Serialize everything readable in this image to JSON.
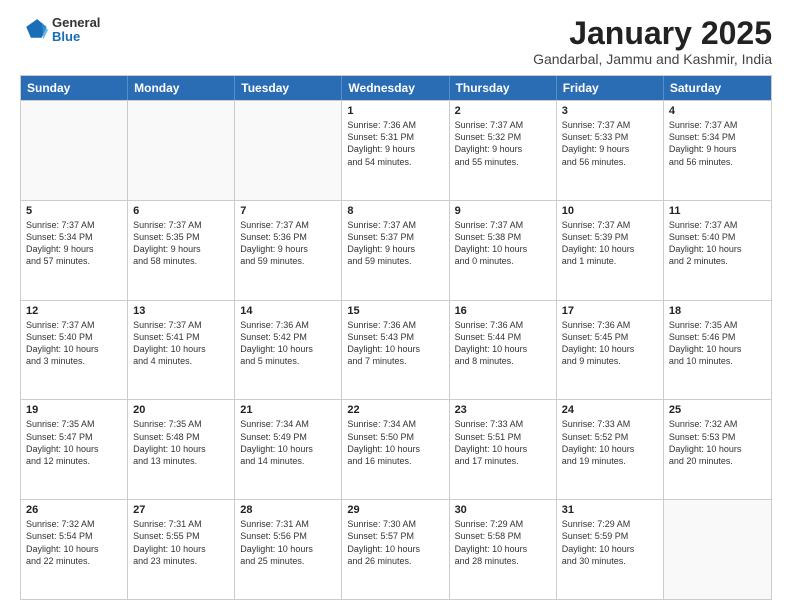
{
  "header": {
    "logo_general": "General",
    "logo_blue": "Blue",
    "month_title": "January 2025",
    "subtitle": "Gandarbal, Jammu and Kashmir, India"
  },
  "days_of_week": [
    "Sunday",
    "Monday",
    "Tuesday",
    "Wednesday",
    "Thursday",
    "Friday",
    "Saturday"
  ],
  "weeks": [
    [
      {
        "day": "",
        "info": []
      },
      {
        "day": "",
        "info": []
      },
      {
        "day": "",
        "info": []
      },
      {
        "day": "1",
        "info": [
          "Sunrise: 7:36 AM",
          "Sunset: 5:31 PM",
          "Daylight: 9 hours",
          "and 54 minutes."
        ]
      },
      {
        "day": "2",
        "info": [
          "Sunrise: 7:37 AM",
          "Sunset: 5:32 PM",
          "Daylight: 9 hours",
          "and 55 minutes."
        ]
      },
      {
        "day": "3",
        "info": [
          "Sunrise: 7:37 AM",
          "Sunset: 5:33 PM",
          "Daylight: 9 hours",
          "and 56 minutes."
        ]
      },
      {
        "day": "4",
        "info": [
          "Sunrise: 7:37 AM",
          "Sunset: 5:34 PM",
          "Daylight: 9 hours",
          "and 56 minutes."
        ]
      }
    ],
    [
      {
        "day": "5",
        "info": [
          "Sunrise: 7:37 AM",
          "Sunset: 5:34 PM",
          "Daylight: 9 hours",
          "and 57 minutes."
        ]
      },
      {
        "day": "6",
        "info": [
          "Sunrise: 7:37 AM",
          "Sunset: 5:35 PM",
          "Daylight: 9 hours",
          "and 58 minutes."
        ]
      },
      {
        "day": "7",
        "info": [
          "Sunrise: 7:37 AM",
          "Sunset: 5:36 PM",
          "Daylight: 9 hours",
          "and 59 minutes."
        ]
      },
      {
        "day": "8",
        "info": [
          "Sunrise: 7:37 AM",
          "Sunset: 5:37 PM",
          "Daylight: 9 hours",
          "and 59 minutes."
        ]
      },
      {
        "day": "9",
        "info": [
          "Sunrise: 7:37 AM",
          "Sunset: 5:38 PM",
          "Daylight: 10 hours",
          "and 0 minutes."
        ]
      },
      {
        "day": "10",
        "info": [
          "Sunrise: 7:37 AM",
          "Sunset: 5:39 PM",
          "Daylight: 10 hours",
          "and 1 minute."
        ]
      },
      {
        "day": "11",
        "info": [
          "Sunrise: 7:37 AM",
          "Sunset: 5:40 PM",
          "Daylight: 10 hours",
          "and 2 minutes."
        ]
      }
    ],
    [
      {
        "day": "12",
        "info": [
          "Sunrise: 7:37 AM",
          "Sunset: 5:40 PM",
          "Daylight: 10 hours",
          "and 3 minutes."
        ]
      },
      {
        "day": "13",
        "info": [
          "Sunrise: 7:37 AM",
          "Sunset: 5:41 PM",
          "Daylight: 10 hours",
          "and 4 minutes."
        ]
      },
      {
        "day": "14",
        "info": [
          "Sunrise: 7:36 AM",
          "Sunset: 5:42 PM",
          "Daylight: 10 hours",
          "and 5 minutes."
        ]
      },
      {
        "day": "15",
        "info": [
          "Sunrise: 7:36 AM",
          "Sunset: 5:43 PM",
          "Daylight: 10 hours",
          "and 7 minutes."
        ]
      },
      {
        "day": "16",
        "info": [
          "Sunrise: 7:36 AM",
          "Sunset: 5:44 PM",
          "Daylight: 10 hours",
          "and 8 minutes."
        ]
      },
      {
        "day": "17",
        "info": [
          "Sunrise: 7:36 AM",
          "Sunset: 5:45 PM",
          "Daylight: 10 hours",
          "and 9 minutes."
        ]
      },
      {
        "day": "18",
        "info": [
          "Sunrise: 7:35 AM",
          "Sunset: 5:46 PM",
          "Daylight: 10 hours",
          "and 10 minutes."
        ]
      }
    ],
    [
      {
        "day": "19",
        "info": [
          "Sunrise: 7:35 AM",
          "Sunset: 5:47 PM",
          "Daylight: 10 hours",
          "and 12 minutes."
        ]
      },
      {
        "day": "20",
        "info": [
          "Sunrise: 7:35 AM",
          "Sunset: 5:48 PM",
          "Daylight: 10 hours",
          "and 13 minutes."
        ]
      },
      {
        "day": "21",
        "info": [
          "Sunrise: 7:34 AM",
          "Sunset: 5:49 PM",
          "Daylight: 10 hours",
          "and 14 minutes."
        ]
      },
      {
        "day": "22",
        "info": [
          "Sunrise: 7:34 AM",
          "Sunset: 5:50 PM",
          "Daylight: 10 hours",
          "and 16 minutes."
        ]
      },
      {
        "day": "23",
        "info": [
          "Sunrise: 7:33 AM",
          "Sunset: 5:51 PM",
          "Daylight: 10 hours",
          "and 17 minutes."
        ]
      },
      {
        "day": "24",
        "info": [
          "Sunrise: 7:33 AM",
          "Sunset: 5:52 PM",
          "Daylight: 10 hours",
          "and 19 minutes."
        ]
      },
      {
        "day": "25",
        "info": [
          "Sunrise: 7:32 AM",
          "Sunset: 5:53 PM",
          "Daylight: 10 hours",
          "and 20 minutes."
        ]
      }
    ],
    [
      {
        "day": "26",
        "info": [
          "Sunrise: 7:32 AM",
          "Sunset: 5:54 PM",
          "Daylight: 10 hours",
          "and 22 minutes."
        ]
      },
      {
        "day": "27",
        "info": [
          "Sunrise: 7:31 AM",
          "Sunset: 5:55 PM",
          "Daylight: 10 hours",
          "and 23 minutes."
        ]
      },
      {
        "day": "28",
        "info": [
          "Sunrise: 7:31 AM",
          "Sunset: 5:56 PM",
          "Daylight: 10 hours",
          "and 25 minutes."
        ]
      },
      {
        "day": "29",
        "info": [
          "Sunrise: 7:30 AM",
          "Sunset: 5:57 PM",
          "Daylight: 10 hours",
          "and 26 minutes."
        ]
      },
      {
        "day": "30",
        "info": [
          "Sunrise: 7:29 AM",
          "Sunset: 5:58 PM",
          "Daylight: 10 hours",
          "and 28 minutes."
        ]
      },
      {
        "day": "31",
        "info": [
          "Sunrise: 7:29 AM",
          "Sunset: 5:59 PM",
          "Daylight: 10 hours",
          "and 30 minutes."
        ]
      },
      {
        "day": "",
        "info": []
      }
    ]
  ]
}
